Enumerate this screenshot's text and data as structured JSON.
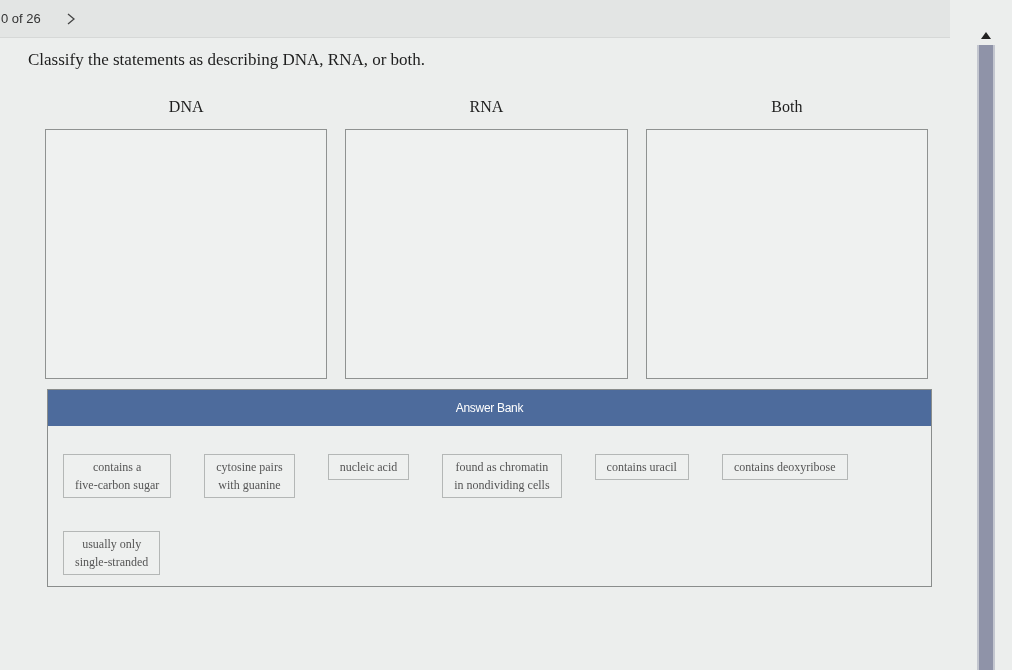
{
  "progress": {
    "counter": "0 of 26"
  },
  "question": "Classify the statements as describing DNA, RNA, or both.",
  "categories": [
    {
      "label": "DNA"
    },
    {
      "label": "RNA"
    },
    {
      "label": "Both"
    }
  ],
  "answer_bank": {
    "title": "Answer Bank",
    "items": [
      {
        "lines": [
          "contains a",
          "five-carbon sugar"
        ]
      },
      {
        "lines": [
          "cytosine pairs",
          "with guanine"
        ]
      },
      {
        "lines": [
          "nucleic acid"
        ]
      },
      {
        "lines": [
          "found as chromatin",
          "in nondividing cells"
        ]
      },
      {
        "lines": [
          "contains uracil"
        ]
      },
      {
        "lines": [
          "contains deoxyribose"
        ]
      },
      {
        "lines": [
          "usually only",
          "single-stranded"
        ]
      }
    ]
  }
}
